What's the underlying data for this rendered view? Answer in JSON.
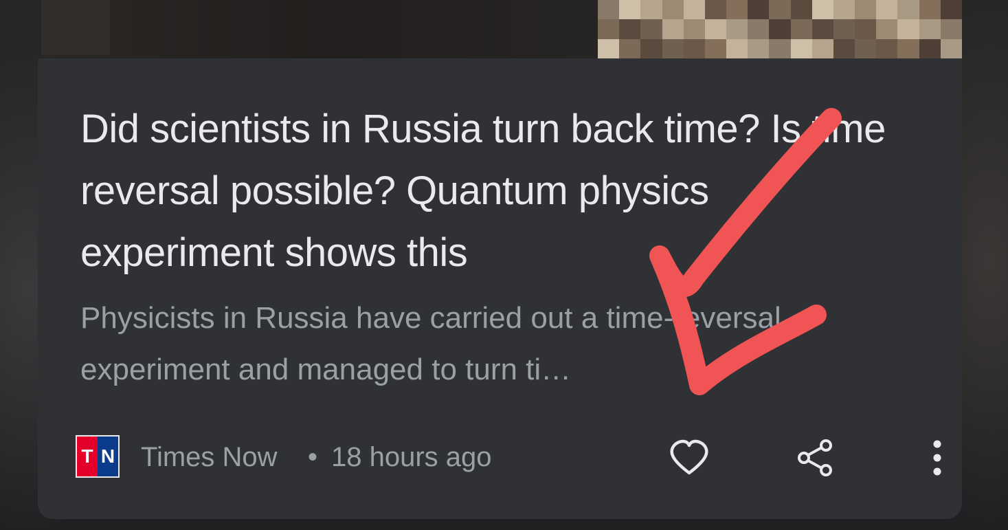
{
  "article": {
    "headline": "Did scientists in Russia turn back time? Is time reversal possible? Quantum physics experiment shows this",
    "snippet": "Physicists in Russia have carried out a time-reversal experiment and managed to turn ti…"
  },
  "source": {
    "logo_text_left": "T",
    "logo_text_right": "N",
    "name": "Times Now",
    "separator": "•",
    "timestamp": "18 hours ago"
  },
  "actions": {
    "like_icon": "heart-outline-icon",
    "share_icon": "share-icon",
    "more_icon": "more-vertical-icon"
  },
  "annotation": {
    "type": "hand-drawn-arrow",
    "color": "#f05454"
  }
}
